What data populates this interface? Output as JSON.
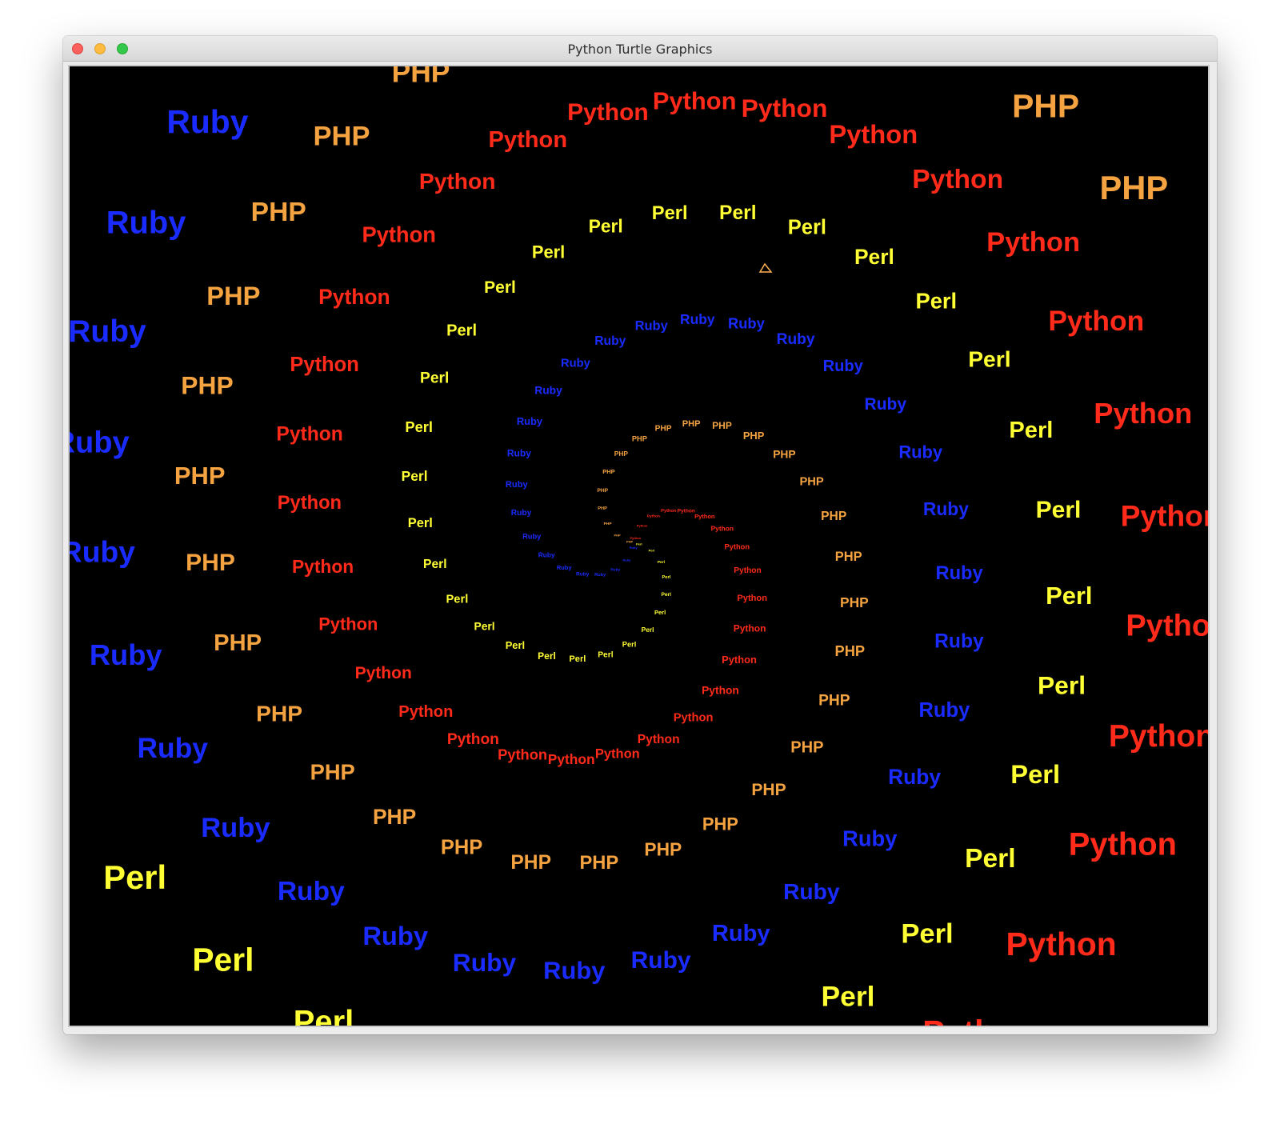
{
  "window": {
    "title": "Python Turtle Graphics",
    "controls": [
      "close",
      "minimize",
      "zoom"
    ]
  },
  "canvas": {
    "background": "#000000",
    "turtle_icon": "triangle-turtle-cursor",
    "colors": {
      "Python": "#ff2a1a",
      "Perl": "#ffff33",
      "Ruby": "#1a2bff",
      "PHP": "#f4a340",
      "turtle": "#ffb050"
    },
    "words": [
      "Python",
      "Perl",
      "Ruby",
      "PHP"
    ],
    "pattern": "spiral of repeating words: Python, Perl, Ruby, PHP"
  }
}
